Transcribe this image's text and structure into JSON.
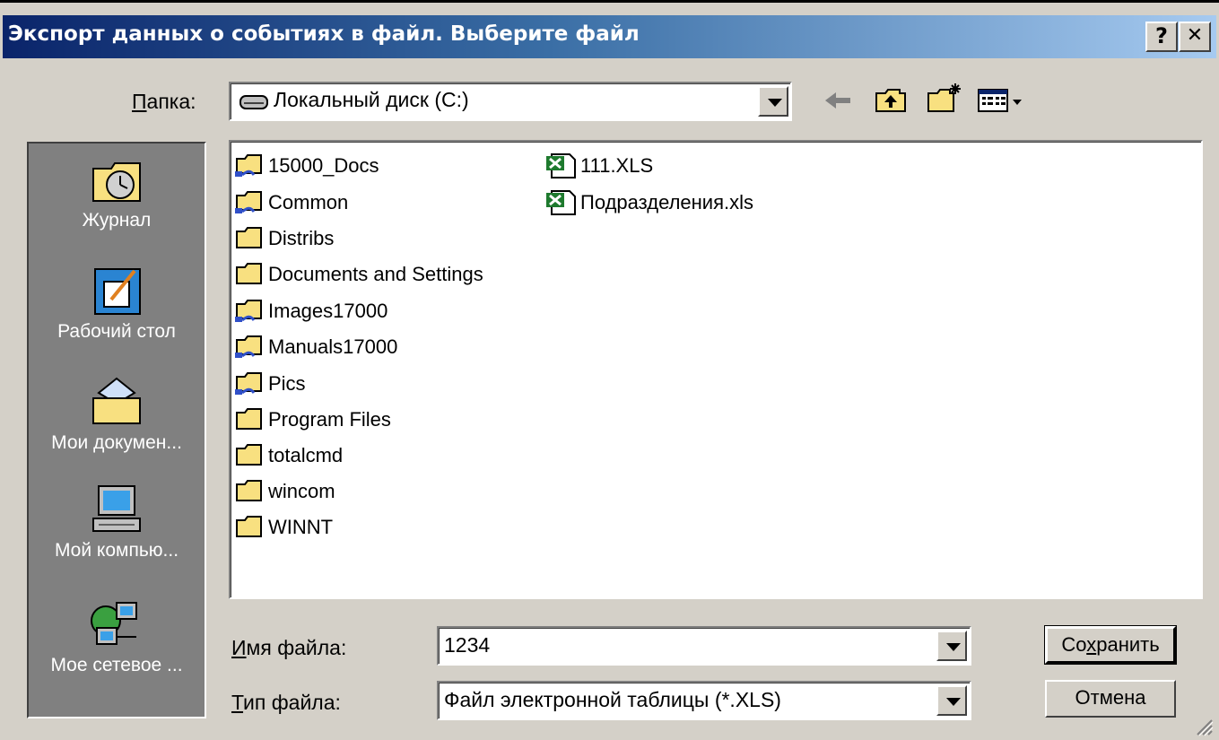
{
  "dialog": {
    "title": "Экспорт данных о событиях в файл. Выберите файл",
    "help_btn": "?",
    "close_btn": "✕"
  },
  "lookin": {
    "label_accel": "П",
    "label_rest": "апка:",
    "value": "Локальный диск (C:)"
  },
  "places": [
    {
      "label": "Журнал",
      "icon": "history-clock-icon"
    },
    {
      "label": "Рабочий стол",
      "icon": "desktop-icon"
    },
    {
      "label": "Мои докумен...",
      "icon": "my-documents-folder-icon"
    },
    {
      "label": "Мой компью...",
      "icon": "my-computer-icon"
    },
    {
      "label": "Мое сетевое ...",
      "icon": "network-places-icon"
    }
  ],
  "files": {
    "col1": [
      {
        "name": "15000_Docs",
        "icon": "shared-folder-icon"
      },
      {
        "name": "Common",
        "icon": "shared-folder-icon"
      },
      {
        "name": "Distribs",
        "icon": "folder-icon"
      },
      {
        "name": "Documents and Settings",
        "icon": "folder-icon"
      },
      {
        "name": "Images17000",
        "icon": "shared-folder-icon"
      },
      {
        "name": "Manuals17000",
        "icon": "shared-folder-icon"
      },
      {
        "name": "Pics",
        "icon": "shared-folder-icon"
      },
      {
        "name": "Program Files",
        "icon": "folder-icon"
      },
      {
        "name": "totalcmd",
        "icon": "folder-icon"
      },
      {
        "name": "wincom",
        "icon": "folder-icon"
      },
      {
        "name": "WINNT",
        "icon": "folder-icon"
      }
    ],
    "col2": [
      {
        "name": "111.XLS",
        "icon": "excel-file-icon"
      },
      {
        "name": "Подразделения.xls",
        "icon": "excel-file-icon"
      }
    ]
  },
  "filename": {
    "label_accel": "И",
    "label_rest": "мя файла:",
    "value": "1234"
  },
  "filetype": {
    "label_accel": "Т",
    "label_rest": "ип файла:",
    "value": "Файл электронной таблицы (*.XLS)"
  },
  "buttons": {
    "save_pre": "Со",
    "save_accel": "х",
    "save_post": "ранить",
    "cancel": "Отмена"
  },
  "colors": {
    "title_start": "#0a246a",
    "title_end": "#a6caf0",
    "face": "#d4d0c8",
    "places_bg": "#808080",
    "folder": "#f8e080"
  }
}
